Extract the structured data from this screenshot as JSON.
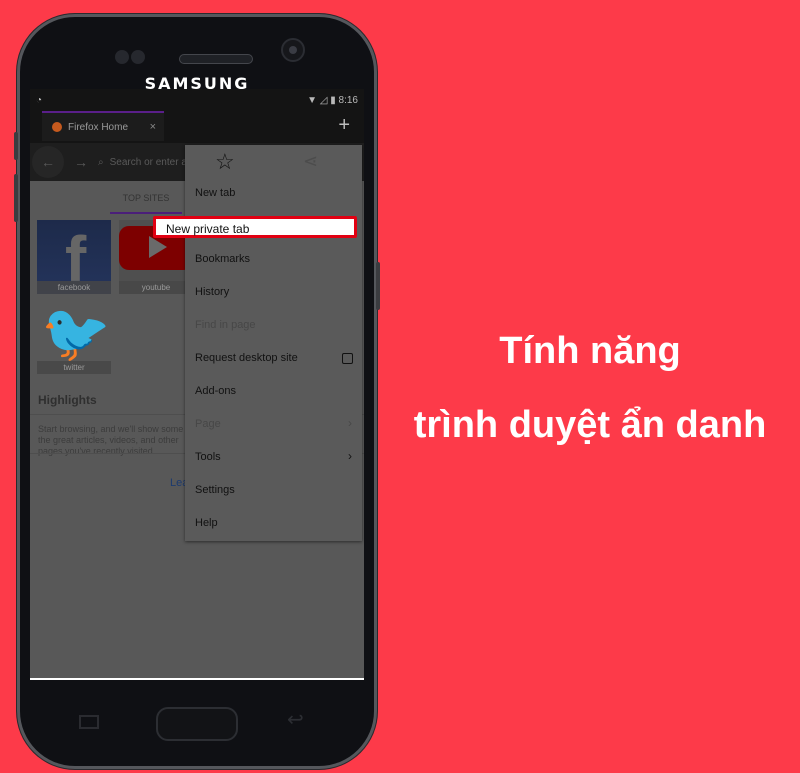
{
  "phone": {
    "brand": "SAMSUNG"
  },
  "statusbar": {
    "time": "8:16",
    "icons": [
      "firefox-icon",
      "wifi-icon",
      "no-sim-icon",
      "battery-icon"
    ]
  },
  "browser": {
    "tab_title": "Firefox Home",
    "tab_close": "×",
    "new_tab": "+",
    "back": "←",
    "forward": "→",
    "search_placeholder": "Search or enter address",
    "panel_tab": "TOP SITES",
    "top_sites": [
      {
        "label": "facebook",
        "icon": "facebook-icon"
      },
      {
        "label": "youtube",
        "icon": "youtube-icon"
      },
      {
        "label": "twitter",
        "icon": "twitter-icon"
      }
    ],
    "highlights_title": "Highlights",
    "highlights_text": "Start browsing, and we'll show some of the great articles, videos, and other pages you've recently visited",
    "learn_more": "Learn more"
  },
  "menu": {
    "items": [
      {
        "label": "New tab",
        "enabled": true
      },
      {
        "label": "New private tab",
        "enabled": true,
        "highlighted": true
      },
      {
        "label": "Bookmarks",
        "enabled": true
      },
      {
        "label": "History",
        "enabled": true
      },
      {
        "label": "Find in page",
        "enabled": false
      },
      {
        "label": "Request desktop site",
        "enabled": true,
        "checkbox": false
      },
      {
        "label": "Add-ons",
        "enabled": true
      },
      {
        "label": "Page",
        "enabled": false,
        "submenu": true
      },
      {
        "label": "Tools",
        "enabled": true,
        "submenu": true
      },
      {
        "label": "Settings",
        "enabled": true
      },
      {
        "label": "Help",
        "enabled": true
      }
    ]
  },
  "headline": {
    "line1": "Tính năng",
    "line2": "trình duyệt ẩn danh"
  },
  "colors": {
    "background": "#fd3a49",
    "highlight_border": "#e10012",
    "tab_accent": "#5a1f8a"
  }
}
